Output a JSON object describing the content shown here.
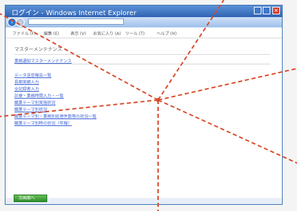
{
  "window": {
    "title": "ログイン - Windows Internet Explorer"
  },
  "menubar": {
    "items": [
      "ファイル (F)",
      "編集 (E)",
      "表示 (V)",
      "お気に入り (A)",
      "ツール (T)",
      "ヘルプ (H)"
    ]
  },
  "page": {
    "section_title": "マスターメンテナンス",
    "main_link": "業務通知マスターメンテナンス",
    "links": [
      "データ送信報告一覧",
      "長期実績入力",
      "全記録者入力",
      "診療・業務時間入力・一覧",
      "職業テーマ別実施状況",
      "職業テーマ別状況",
      "職業テーマ別・業務別処理件数等の状況一覧",
      "職業テーマ別時の状況（年報）"
    ]
  },
  "status": {
    "button_label": "次画面へ"
  }
}
